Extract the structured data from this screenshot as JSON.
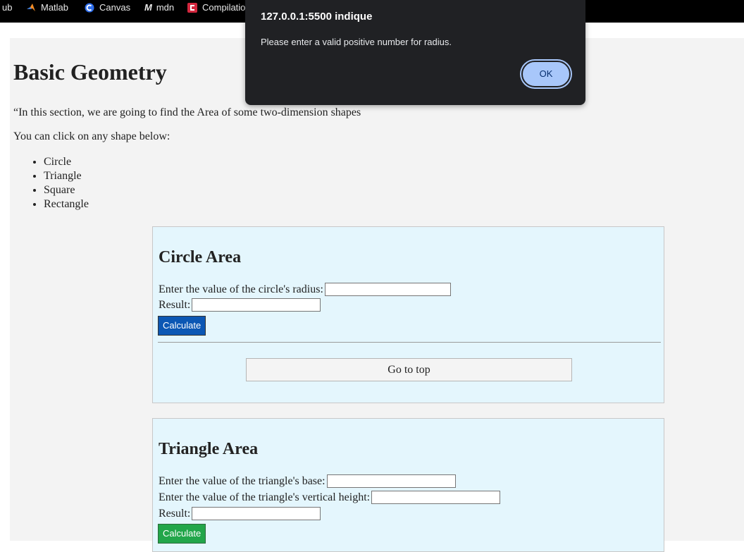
{
  "bookmarks": [
    {
      "label": "ub",
      "icon": "github-icon"
    },
    {
      "label": "Matlab",
      "icon": "matlab-icon"
    },
    {
      "label": "Canvas",
      "icon": "canvas-icon"
    },
    {
      "label": "mdn",
      "icon": "mdn-icon"
    },
    {
      "label": "Compilatio",
      "icon": "compilatio-icon"
    }
  ],
  "alert": {
    "title": "127.0.0.1:5500 indique",
    "message": "Please enter a valid positive number for radius.",
    "ok_label": "OK"
  },
  "page": {
    "title": "Basic Geometry",
    "intro": "“In this section, we are going to find the Area of some two-dimension shapes",
    "click_hint": "You can click on any shape below:",
    "shapes": [
      "Circle",
      "Triangle",
      "Square",
      "Rectangle"
    ]
  },
  "circle_card": {
    "title": "Circle Area",
    "radius_label": "Enter the value of the circle's radius:",
    "radius_value": "",
    "result_label": "Result:",
    "result_value": "",
    "calculate_label": "Calculate",
    "goto_top_label": "Go to top"
  },
  "triangle_card": {
    "title": "Triangle Area",
    "base_label": "Enter the value of the triangle's base:",
    "base_value": "",
    "height_label": "Enter the value of the triangle's vertical height:",
    "height_value": "",
    "result_label": "Result:",
    "result_value": "",
    "calculate_label": "Calculate"
  },
  "colors": {
    "circle_button": "#0b57b4",
    "triangle_button": "#22a64a",
    "card_background": "#e4f6fd",
    "page_background": "#f3f3f3",
    "dialog_background": "#202124",
    "ok_button": "#a8c7fa"
  }
}
